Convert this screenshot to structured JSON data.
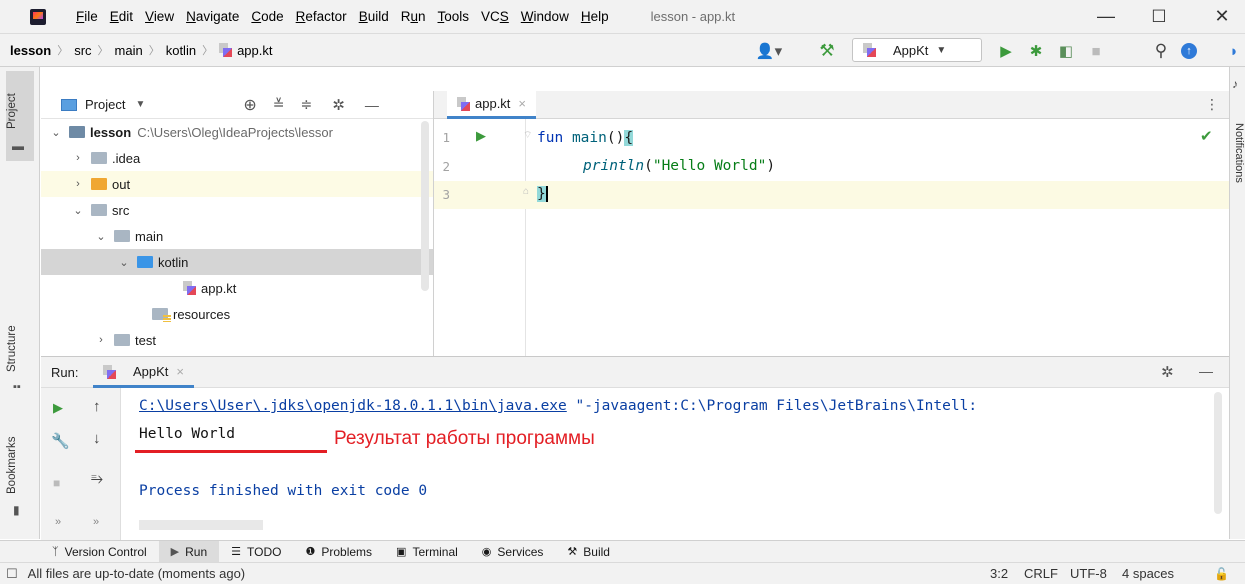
{
  "menubar": {
    "items": [
      {
        "label": "File",
        "key": "F",
        "rest": "ile"
      },
      {
        "label": "Edit",
        "key": "E",
        "rest": "dit"
      },
      {
        "label": "View",
        "key": "V",
        "rest": "iew"
      },
      {
        "label": "Navigate",
        "key": "N",
        "rest": "avigate"
      },
      {
        "label": "Code",
        "key": "C",
        "rest": "ode"
      },
      {
        "label": "Refactor",
        "key": "R",
        "rest": "efactor"
      },
      {
        "label": "Build",
        "key": "B",
        "rest": "uild"
      },
      {
        "label": "Run",
        "pre": "R",
        "key": "u",
        "rest": "n"
      },
      {
        "label": "Tools",
        "key": "T",
        "rest": "ools"
      },
      {
        "label": "VCS",
        "pre": "VC",
        "key": "S",
        "rest": ""
      },
      {
        "label": "Window",
        "key": "W",
        "rest": "indow"
      },
      {
        "label": "Help",
        "key": "H",
        "rest": "elp"
      }
    ],
    "window_title": "lesson - app.kt",
    "minimize": "—",
    "maximize": "☐",
    "close": "✕"
  },
  "navbar": {
    "crumbs": [
      "lesson",
      "src",
      "main",
      "kotlin",
      "app.kt"
    ],
    "run_config": "AppKt"
  },
  "left_strip": {
    "project": "Project",
    "structure": "Structure",
    "bookmarks": "Bookmarks"
  },
  "right_strip": {
    "notifications": "Notifications"
  },
  "project_panel": {
    "title": "Project",
    "tree": [
      {
        "name": "lesson",
        "path": "C:\\Users\\Oleg\\IdeaProjects\\lessor",
        "chev": "⌄",
        "indent": 0
      },
      {
        "name": ".idea",
        "chev": "›",
        "indent": 1
      },
      {
        "name": "out",
        "chev": "›",
        "indent": 1
      },
      {
        "name": "src",
        "chev": "⌄",
        "indent": 1
      },
      {
        "name": "main",
        "chev": "⌄",
        "indent": 2
      },
      {
        "name": "kotlin",
        "chev": "⌄",
        "indent": 3
      },
      {
        "name": "app.kt",
        "indent": 4
      },
      {
        "name": "resources",
        "indent": 3
      },
      {
        "name": "test",
        "chev": "›",
        "indent": 2
      }
    ]
  },
  "editor": {
    "tab_label": "app.kt",
    "tab_close": "×",
    "line_numbers": [
      "1",
      "2",
      "3"
    ],
    "code": {
      "line1_kw": "fun",
      "line1_fn": "main",
      "line1_parens": "()",
      "line1_brace": "{",
      "line2_fn": "println",
      "line2_open": "(",
      "line2_str": "\"Hello World\"",
      "line2_close": ")",
      "line3_brace": "}"
    }
  },
  "run_panel": {
    "label": "Run:",
    "tab_label": "AppKt",
    "tab_close": "×",
    "console": {
      "cmd_path": "C:\\Users\\User\\.jdks\\openjdk-18.0.1.1\\bin\\java.exe",
      "cmd_args": " \"-javaagent:C:\\Program Files\\JetBrains\\Intell:",
      "output": "Hello World",
      "annotation": "Результат работы программы",
      "exit": "Process finished with exit code 0"
    }
  },
  "bottom_tabs": [
    {
      "label": "Version Control",
      "icon": "version-control-icon"
    },
    {
      "label": "Run",
      "icon": "run-icon"
    },
    {
      "label": "TODO",
      "icon": "todo-icon"
    },
    {
      "label": "Problems",
      "icon": "problems-icon"
    },
    {
      "label": "Terminal",
      "icon": "terminal-icon"
    },
    {
      "label": "Services",
      "icon": "services-icon"
    },
    {
      "label": "Build",
      "icon": "build-icon"
    }
  ],
  "statusbar": {
    "message": "All files are up-to-date (moments ago)",
    "position": "3:2",
    "line_sep": "CRLF",
    "encoding": "UTF-8",
    "indent": "4 spaces"
  },
  "colors": {
    "accent": "#4083c9",
    "annotation_red": "#e31e24",
    "run_green": "#3c9a3c",
    "link_blue": "#0a3fa3"
  }
}
